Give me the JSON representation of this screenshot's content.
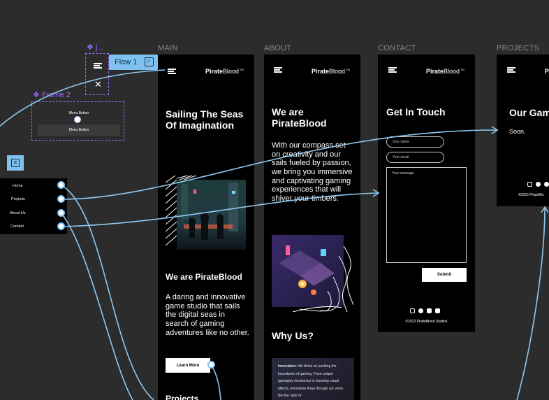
{
  "canvas": {
    "background": "#2c2c2c",
    "accent_flow": "#8ec9f2",
    "component_purple": "#9f6dff"
  },
  "frames": {
    "main": "MAIN",
    "about": "ABOUT",
    "contact": "CONTACT",
    "projects": "PROJECTS"
  },
  "components": {
    "j_label": "j...",
    "frame2_label": "Frame 2",
    "frame2_btn1": "Menu Button",
    "frame2_btn2": "Menu Button"
  },
  "flow": {
    "label": "Flow 1"
  },
  "menu": {
    "items": [
      "Home",
      "Projects",
      "About Us",
      "Contact"
    ]
  },
  "brand": {
    "bold": "Pirate",
    "light": "Blood",
    "tm": "TM"
  },
  "main": {
    "hero": "Sailing The Seas Of Imagination",
    "subheading": "We are PirateBlood",
    "paragraph": "A daring and innovative game studio that sails the digital seas in search of gaming adventures like no other.",
    "learn_more": "Learn More",
    "projects_peek": "Projects"
  },
  "about": {
    "hero": "We are PirateBlood",
    "paragraph": "With our compass set on creativity and our sails fueled by passion, we bring you immersive and captivating gaming experiences that will shiver your timbers.",
    "why_us": "Why Us?",
    "innovation_bold": "Innovation:",
    "innovation_text": " We thrive on pushing the boundaries of gaming. From unique gameplay mechanics to stunning visual effects, innovation flows through our veins like the spirit of"
  },
  "contact": {
    "title": "Get In Touch",
    "name_placeholder": "Your name",
    "email_placeholder": "Your email",
    "message_placeholder": "Your message",
    "submit": "Submit",
    "copyright": "©2023 PirateBlood Studios"
  },
  "projects": {
    "title": "Our Gam",
    "soon": "Soon.",
    "copyright": "©2023 PirateBlo"
  }
}
